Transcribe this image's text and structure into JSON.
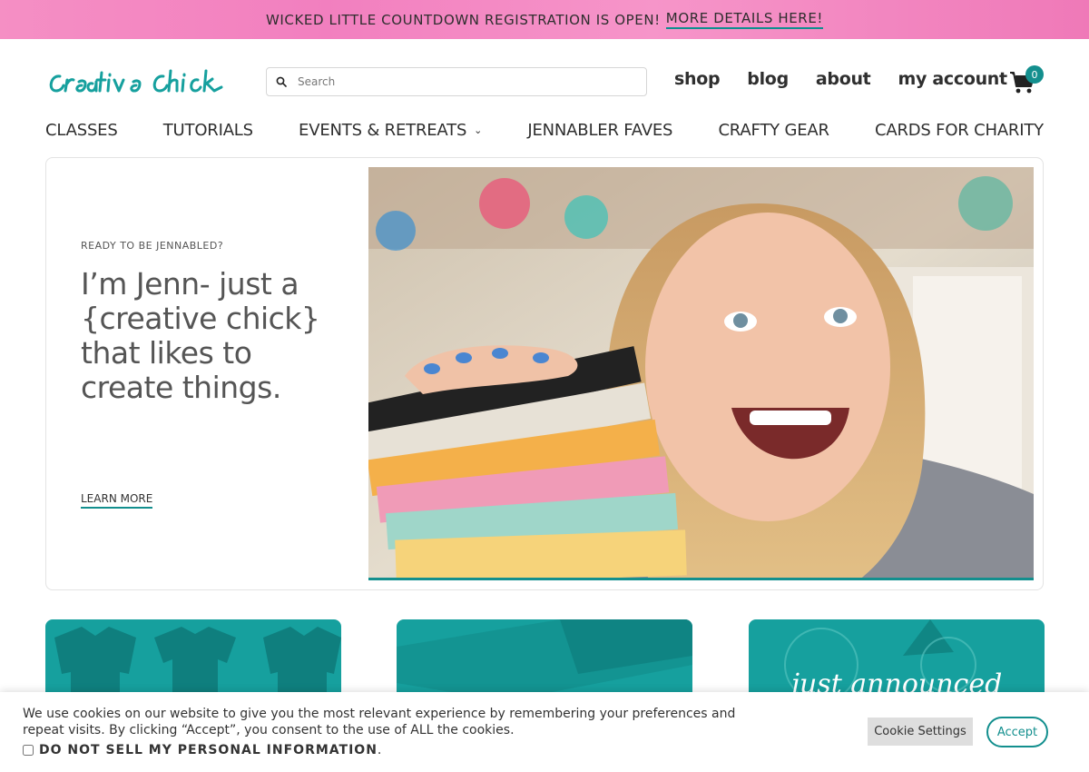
{
  "banner": {
    "text": "WICKED LITTLE COUNTDOWN REGISTRATION IS OPEN!",
    "link": "MORE DETAILS HERE!"
  },
  "header": {
    "logo_text": "creative chick",
    "search_placeholder": "Search",
    "nav": [
      "shop",
      "blog",
      "about",
      "my account"
    ],
    "cart_count": "0"
  },
  "main_nav": [
    {
      "label": "CLASSES"
    },
    {
      "label": "TUTORIALS"
    },
    {
      "label": "EVENTS & RETREATS",
      "chevron": "⌄"
    },
    {
      "label": "JENNABLER FAVES"
    },
    {
      "label": "CRAFTY GEAR"
    },
    {
      "label": "CARDS FOR CHARITY"
    }
  ],
  "hero": {
    "eyebrow": "READY TO BE JENNABLED?",
    "headline": "I’m Jenn- just a {creative chick} that likes to create things.",
    "cta": "LEARN MORE"
  },
  "cards": [
    {
      "script": ""
    },
    {
      "script": ""
    },
    {
      "script": "just announced"
    }
  ],
  "cookie": {
    "message": "We use cookies on our website to give you the most relevant experience by remembering your preferences and repeat visits. By clicking “Accept”, you consent to the use of ALL the cookies.",
    "dns_label": "DO NOT SELL MY PERSONAL INFORMATION",
    "dns_suffix": ".",
    "settings_label": "Cookie Settings",
    "accept_label": "Accept"
  },
  "colors": {
    "accent": "#138f8e",
    "banner_pink": "#f58fc4"
  }
}
